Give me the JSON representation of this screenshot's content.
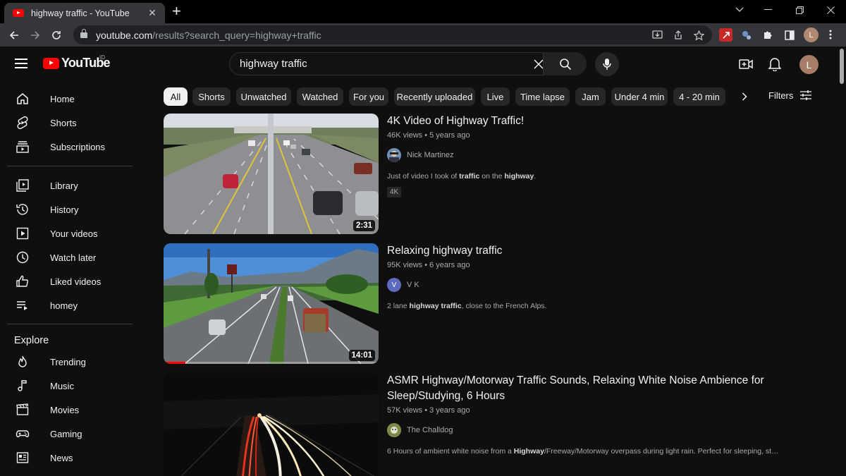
{
  "browser": {
    "tab_title": "highway traffic - YouTube",
    "tab_close": "✕",
    "new_tab": "+",
    "url_host": "youtube.com",
    "url_path": "/results?search_query=highway+traffic",
    "profile_initial": "L"
  },
  "masthead": {
    "logo_text": "YouTube",
    "country_code": "ID",
    "search_value": "highway traffic",
    "avatar_initial": "L"
  },
  "sidebar": {
    "items": [
      {
        "label": "Home",
        "icon": "home-icon"
      },
      {
        "label": "Shorts",
        "icon": "shorts-icon"
      },
      {
        "label": "Subscriptions",
        "icon": "subscriptions-icon"
      }
    ],
    "library": [
      {
        "label": "Library",
        "icon": "library-icon"
      },
      {
        "label": "History",
        "icon": "history-icon"
      },
      {
        "label": "Your videos",
        "icon": "your-videos-icon"
      },
      {
        "label": "Watch later",
        "icon": "watch-later-icon"
      },
      {
        "label": "Liked videos",
        "icon": "liked-icon"
      },
      {
        "label": "homey",
        "icon": "playlist-icon"
      }
    ],
    "explore_heading": "Explore",
    "explore": [
      {
        "label": "Trending",
        "icon": "trending-icon"
      },
      {
        "label": "Music",
        "icon": "music-icon"
      },
      {
        "label": "Movies",
        "icon": "movies-icon"
      },
      {
        "label": "Gaming",
        "icon": "gaming-icon"
      },
      {
        "label": "News",
        "icon": "news-icon"
      }
    ]
  },
  "chips": [
    "All",
    "Shorts",
    "Unwatched",
    "Watched",
    "For you",
    "Recently uploaded",
    "Live",
    "Time lapse",
    "Jam",
    "Under 4 min",
    "4 - 20 min"
  ],
  "filters_label": "Filters",
  "results": [
    {
      "title": "4K Video of Highway Traffic!",
      "meta": "46K views • 5 years ago",
      "channel": "Nick Martinez",
      "desc_parts": [
        "Just of video I took of ",
        "traffic",
        " on the ",
        "highway",
        "."
      ],
      "badge": "4K",
      "duration": "2:31"
    },
    {
      "title": "Relaxing highway traffic",
      "meta": "95K views • 6 years ago",
      "channel": "V K",
      "channel_initial": "V",
      "desc_parts": [
        "2 lane ",
        "highway traffic",
        ", close to the French Alps.",
        "",
        ""
      ],
      "duration": "14:01",
      "watched_fraction": 0.1
    },
    {
      "title": "ASMR Highway/Motorway Traffic Sounds, Relaxing White Noise Ambience for Sleep/Studying, 6 Hours",
      "meta": "57K views • 3 years ago",
      "channel": "The Challdog",
      "desc_parts": [
        "6 Hours of ambient white noise from a ",
        "Highway",
        "/Freeway/Motorway overpass during light rain. Perfect for sleeping, studying, ...",
        "",
        ""
      ]
    }
  ]
}
